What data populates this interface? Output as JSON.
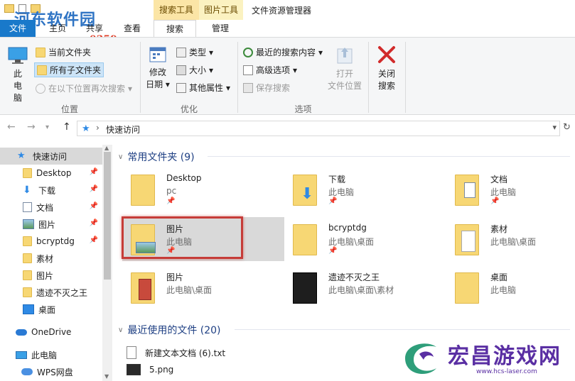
{
  "watermark": {
    "brand": "河东软件园",
    "url": "www.pc0359.cn"
  },
  "window": {
    "title": "文件资源管理器",
    "context_tabs": [
      "搜索工具",
      "图片工具"
    ],
    "tabs": {
      "file": "文件",
      "home": "主页",
      "share": "共享",
      "view": "查看",
      "search": "搜索",
      "manage": "管理"
    }
  },
  "ribbon": {
    "location": {
      "this_pc": "此电脑",
      "current_folder": "当前文件夹",
      "all_subfolders": "所有子文件夹",
      "search_again": "在以下位置再次搜索",
      "label": "位置"
    },
    "refine": {
      "date_modified_1": "修改",
      "date_modified_2": "日期",
      "type": "类型",
      "size": "大小",
      "other_props": "其他属性",
      "label": "优化"
    },
    "options": {
      "recent_searches": "最近的搜索内容",
      "advanced": "高级选项",
      "save_search": "保存搜索",
      "open_location_1": "打开",
      "open_location_2": "文件位置",
      "label": "选项"
    },
    "close": {
      "line1": "关闭",
      "line2": "搜索"
    }
  },
  "address": {
    "path": "快速访问"
  },
  "nav": {
    "items": [
      {
        "label": "快速访问"
      },
      {
        "label": "Desktop"
      },
      {
        "label": "下载"
      },
      {
        "label": "文档"
      },
      {
        "label": "图片"
      },
      {
        "label": "bcryptdg"
      },
      {
        "label": "素材"
      },
      {
        "label": "图片"
      },
      {
        "label": "遗迹不灭之王"
      },
      {
        "label": "桌面"
      },
      {
        "label": "OneDrive"
      },
      {
        "label": "此电脑"
      },
      {
        "label": "WPS网盘"
      }
    ]
  },
  "content": {
    "frequent_header": "常用文件夹 (9)",
    "frequent": [
      {
        "name": "Desktop",
        "sub": "pc"
      },
      {
        "name": "下载",
        "sub": "此电脑"
      },
      {
        "name": "文档",
        "sub": "此电脑"
      },
      {
        "name": "图片",
        "sub": "此电脑"
      },
      {
        "name": "bcryptdg",
        "sub": "此电脑\\桌面"
      },
      {
        "name": "素材",
        "sub": "此电脑\\桌面"
      },
      {
        "name": "图片",
        "sub": "此电脑\\桌面"
      },
      {
        "name": "遗迹不灭之王",
        "sub": "此电脑\\桌面\\素材"
      },
      {
        "name": "桌面",
        "sub": "此电脑"
      }
    ],
    "recent_header": "最近使用的文件 (20)",
    "recent": [
      {
        "name": "新建文本文档 (6).txt"
      },
      {
        "name": "5.png"
      }
    ]
  },
  "logo": {
    "text": "宏昌游戏网",
    "url": "www.hcs-laser.com"
  }
}
